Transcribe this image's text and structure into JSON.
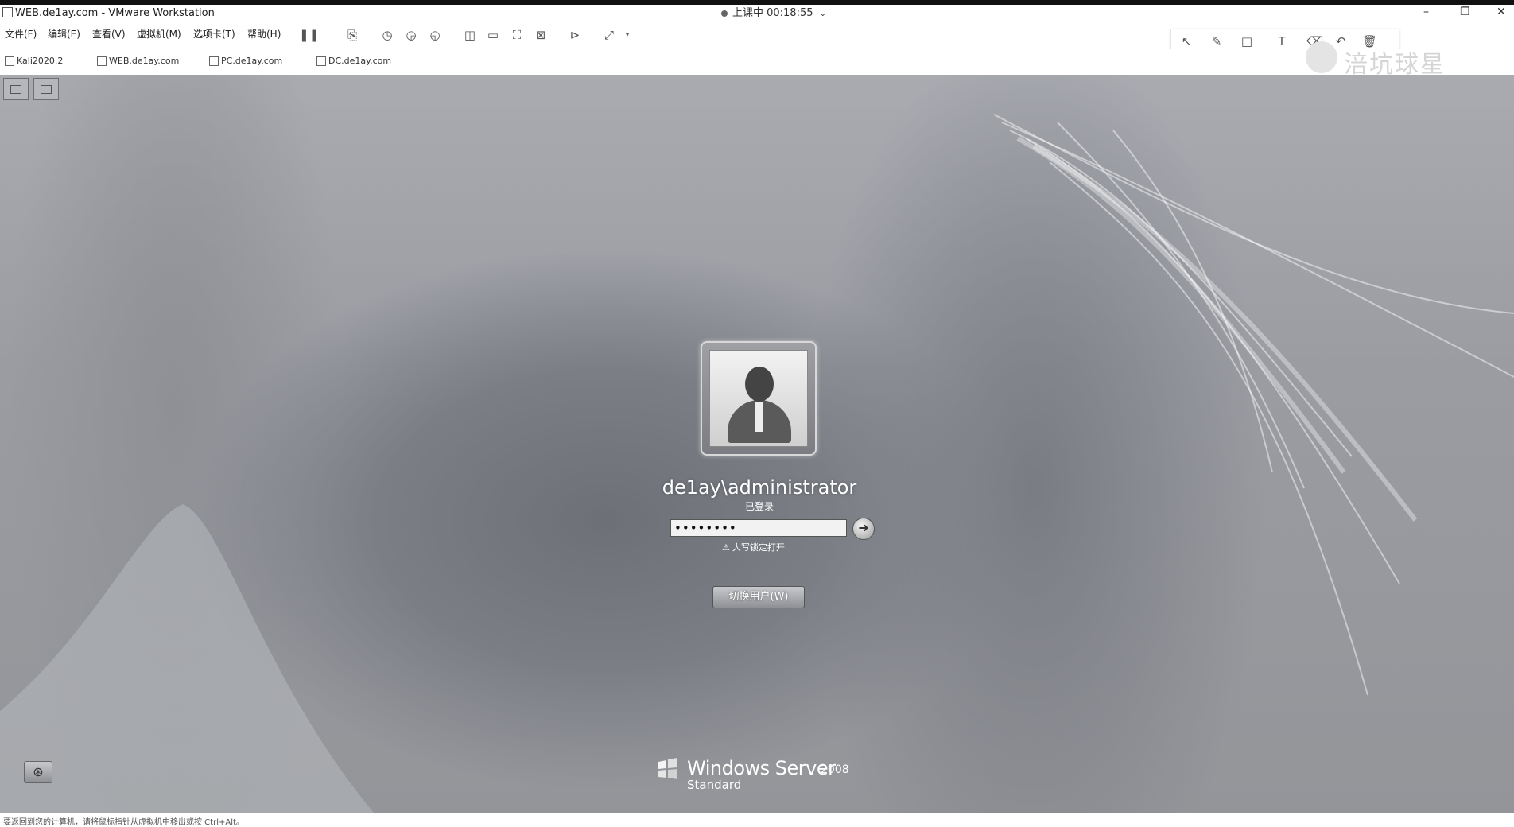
{
  "window": {
    "title": "WEB.de1ay.com - VMware Workstation",
    "recording_label": "上课中 00:18:55",
    "recording_menu_icon": "chevron-down-icon",
    "controls": [
      "minimize-icon",
      "restore-icon",
      "close-icon"
    ]
  },
  "menu": {
    "items": [
      "文件(F)",
      "编辑(E)",
      "查看(V)",
      "虚拟机(M)",
      "选项卡(T)",
      "帮助(H)"
    ]
  },
  "toolbar_icons": [
    "pause-icon",
    "send-ctrl-alt-del-icon",
    "snapshot-icon",
    "revert-snapshot-icon",
    "snapshot-manager-icon",
    "library-icon",
    "tabs-icon",
    "full-screen-icon",
    "unity-icon",
    "console-icon",
    "stretch-icon"
  ],
  "annotation_icons": [
    "pointer-icon",
    "pen-icon",
    "rectangle-icon",
    "text-icon",
    "eraser-icon",
    "undo-icon",
    "delete-icon"
  ],
  "tabs": [
    "Kali2020.2",
    "WEB.de1ay.com",
    "PC.de1ay.com",
    "DC.de1ay.com"
  ],
  "watermark": "涪坑球星",
  "login": {
    "username": "de1ay\\administrator",
    "status": "已登录",
    "password_value": "••••••••",
    "caps_lock_warning": "大写锁定打开",
    "switch_user_label": "切换用户(W)",
    "go_icon": "arrow-right-icon"
  },
  "brand": {
    "name": "Windows Server",
    "year": "2008",
    "edition": "Standard"
  },
  "statusbar_text": "要返回到您的计算机，请将鼠标指针从虚拟机中移出或按 Ctrl+Alt。"
}
